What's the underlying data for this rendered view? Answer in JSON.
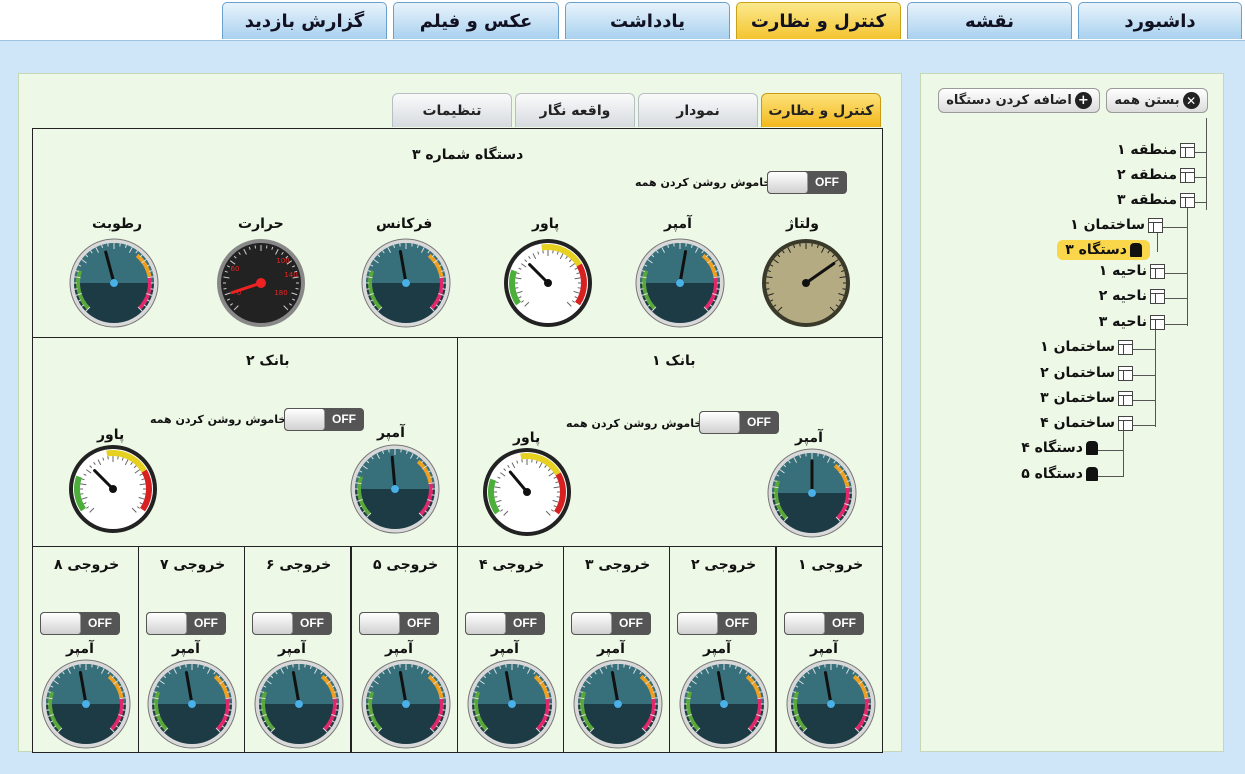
{
  "top_tabs": [
    {
      "label": "داشبورد"
    },
    {
      "label": "نقشه"
    },
    {
      "label": "کنترل و نظارت"
    },
    {
      "label": "یادداشت"
    },
    {
      "label": "عکس و فیلم"
    },
    {
      "label": "گزارش بازدید"
    }
  ],
  "sub_tabs": [
    {
      "label": "کنترل و نظارت"
    },
    {
      "label": "نمودار"
    },
    {
      "label": "واقعه نگار"
    },
    {
      "label": "تنظیمات"
    }
  ],
  "device": {
    "title": "دستگاه شماره ۳",
    "toggle_label": "خاموش روشن کردن همه",
    "toggle_state": "OFF",
    "gauges": [
      {
        "label": "ولتاژ"
      },
      {
        "label": "آمپر"
      },
      {
        "label": "پاور"
      },
      {
        "label": "فرکانس"
      },
      {
        "label": "حرارت"
      },
      {
        "label": "رطوبت"
      }
    ],
    "temp_scale": [
      "100",
      "140",
      "180",
      "0",
      "60"
    ]
  },
  "bank1": {
    "title": "بانک ۱",
    "toggle_label": "خاموش روشن کردن همه",
    "toggle_state": "OFF",
    "gauge1": "پاور",
    "gauge2": "آمپر"
  },
  "bank2": {
    "title": "بانک ۲",
    "toggle_label": "خاموش روشن کردن همه",
    "toggle_state": "OFF",
    "gauge1": "پاور",
    "gauge2": "آمپر"
  },
  "outputs": [
    {
      "title": "خروجی ۱",
      "state": "OFF",
      "gauge": "آمپر"
    },
    {
      "title": "خروجی ۲",
      "state": "OFF",
      "gauge": "آمپر"
    },
    {
      "title": "خروجی ۳",
      "state": "OFF",
      "gauge": "آمپر"
    },
    {
      "title": "خروجی ۴",
      "state": "OFF",
      "gauge": "آمپر"
    },
    {
      "title": "خروجی ۵",
      "state": "OFF",
      "gauge": "آمپر"
    },
    {
      "title": "خروجی ۶",
      "state": "OFF",
      "gauge": "آمپر"
    },
    {
      "title": "خروجی ۷",
      "state": "OFF",
      "gauge": "آمپر"
    },
    {
      "title": "خروجی ۸",
      "state": "OFF",
      "gauge": "آمپر"
    }
  ],
  "sidebar": {
    "close_all": "بستن همه",
    "add_device": "اضافه کردن دستگاه",
    "tree": [
      "منطقه ۱",
      "منطقه ۲",
      "منطقه ۳",
      "ساختمان ۱",
      "دستگاه ۳",
      "ناحیه ۱",
      "ناحیه ۲",
      "ناحیه ۳",
      "ساختمان ۱",
      "ساختمان ۲",
      "ساختمان ۳",
      "ساختمان ۴",
      "دستگاه ۴",
      "دستگاه ۵"
    ]
  },
  "colors": {
    "active_tab": "#f4c430",
    "tab": "#a9d1ef",
    "panel_bg": "#eef8e6",
    "frame_bg": "#cfe6f8"
  },
  "icons": {
    "close": "close-circle-icon",
    "add": "plus-circle-icon",
    "folder": "node-icon",
    "device": "device-icon"
  }
}
